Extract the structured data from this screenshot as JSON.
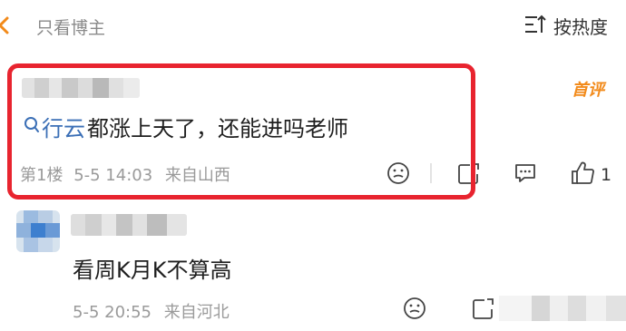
{
  "header": {
    "tab_blogger_only": "只看博主",
    "sort_label": "按热度"
  },
  "comments": [
    {
      "badge": "首评",
      "search_link": "行云",
      "text_after": "都涨上天了，还能进吗老师",
      "floor": "第1楼",
      "time": "5-5 14:03",
      "location": "来自山西",
      "like_count": "1"
    },
    {
      "text": "看周K月K不算高",
      "time": "5-5 20:55",
      "location": "来自河北"
    }
  ],
  "colors": {
    "highlight": "#e8242f",
    "link": "#3b6fb6",
    "badge": "#f28a1a",
    "meta": "#9a9a9a"
  },
  "icons": [
    "chevron-left-icon",
    "sort-icon",
    "search-icon",
    "emoji-icon",
    "repost-icon",
    "comment-icon",
    "thumbs-up-icon"
  ]
}
